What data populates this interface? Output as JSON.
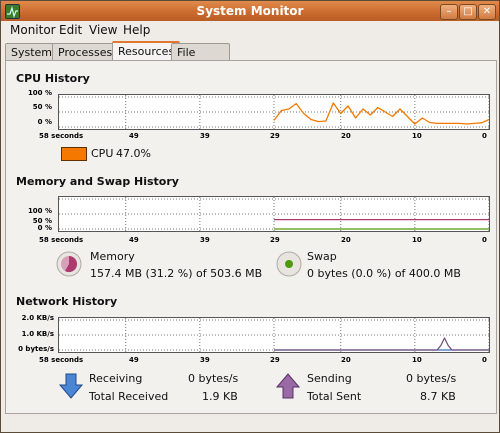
{
  "window": {
    "title": "System Monitor"
  },
  "menu": [
    "Monitor",
    "Edit",
    "View",
    "Help"
  ],
  "tabs": [
    "System",
    "Processes",
    "Resources",
    "File Systems"
  ],
  "active_tab": "Resources",
  "colors": {
    "cpu": "#f57900",
    "memory": "#ad3a6e",
    "swap": "#4e9a06",
    "receiving": "#3a6ec4",
    "sending": "#75507b"
  },
  "cpu": {
    "title": "CPU History",
    "y_ticks": [
      "100 %",
      "50 %",
      "0 %"
    ],
    "legend_label": "CPU",
    "legend_value": "47.0%"
  },
  "mem": {
    "title": "Memory and Swap History",
    "y_ticks": [
      "100 %",
      "50 %",
      "0 %"
    ],
    "memory_label": "Memory",
    "memory_value": "157.4 MB (31.2 %) of 503.6 MB",
    "swap_label": "Swap",
    "swap_value": "0 bytes (0.0 %) of 400.0 MB"
  },
  "net": {
    "title": "Network History",
    "y_ticks": [
      "2.0 KB/s",
      "1.0 KB/s",
      "0 bytes/s"
    ],
    "receiving_label": "Receiving",
    "receiving_value": "0 bytes/s",
    "total_received_label": "Total Received",
    "total_received_value": "1.9 KB",
    "sending_label": "Sending",
    "sending_value": "0 bytes/s",
    "total_sent_label": "Total Sent",
    "total_sent_value": "8.7 KB"
  },
  "x_ticks": [
    "58 seconds",
    "49",
    "39",
    "29",
    "20",
    "10",
    "0"
  ],
  "chart_data": [
    {
      "type": "line",
      "title": "CPU History",
      "xlabel": "",
      "ylabel": "",
      "x": [
        29,
        28,
        27,
        26,
        25,
        24,
        23,
        22,
        21,
        20,
        19,
        18,
        17,
        16,
        15,
        14,
        13,
        12,
        11,
        10,
        9,
        8,
        7,
        6,
        5,
        4,
        3,
        2,
        1,
        0
      ],
      "xlim": [
        58,
        0
      ],
      "ylim": [
        0,
        100
      ],
      "series": [
        {
          "name": "CPU",
          "values": [
            22,
            55,
            60,
            78,
            45,
            25,
            18,
            20,
            80,
            45,
            70,
            30,
            60,
            40,
            65,
            50,
            35,
            60,
            35,
            10,
            30,
            15,
            12,
            12,
            12,
            12,
            10,
            12,
            14,
            25
          ]
        }
      ]
    },
    {
      "type": "line",
      "title": "Memory and Swap History",
      "xlabel": "",
      "ylabel": "",
      "x": [
        29,
        20,
        10,
        0
      ],
      "xlim": [
        58,
        0
      ],
      "ylim": [
        0,
        100
      ],
      "series": [
        {
          "name": "Memory",
          "values": [
            31.2,
            31.2,
            31.2,
            31.2
          ]
        },
        {
          "name": "Swap",
          "values": [
            0,
            0,
            0,
            0
          ]
        }
      ]
    },
    {
      "type": "line",
      "title": "Network History",
      "xlabel": "",
      "ylabel": "",
      "x": [
        29,
        20,
        10,
        7,
        6.5,
        6,
        5.5,
        5,
        0
      ],
      "xlim": [
        58,
        0
      ],
      "ylim": [
        0,
        2.0
      ],
      "series": [
        {
          "name": "Receiving",
          "values": [
            0,
            0,
            0,
            0,
            0,
            0,
            0,
            0,
            0
          ]
        },
        {
          "name": "Sending",
          "values": [
            0,
            0,
            0,
            0,
            0.3,
            0.8,
            0.3,
            0,
            0
          ]
        }
      ]
    }
  ]
}
